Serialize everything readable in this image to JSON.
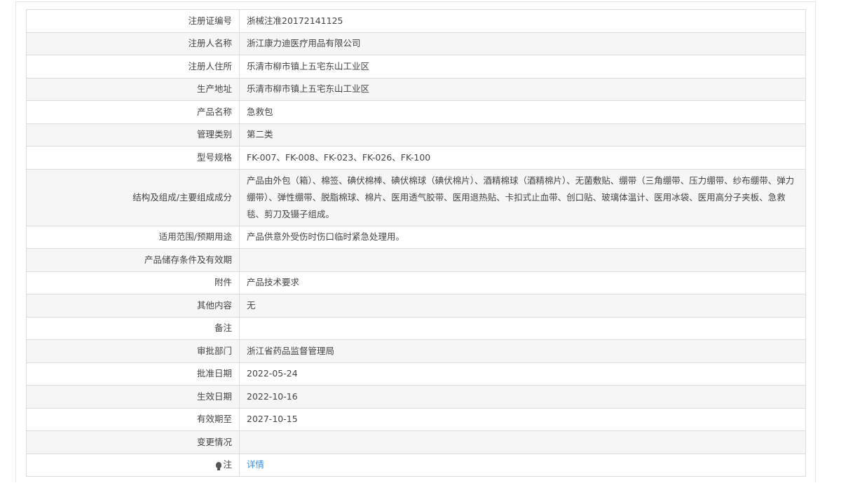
{
  "rows": [
    {
      "label": "注册证编号",
      "value": "浙械注准20172141125"
    },
    {
      "label": "注册人名称",
      "value": "浙江康力迪医疗用品有限公司"
    },
    {
      "label": "注册人住所",
      "value": "乐清市柳市镇上五宅东山工业区"
    },
    {
      "label": "生产地址",
      "value": "乐清市柳市镇上五宅东山工业区"
    },
    {
      "label": "产品名称",
      "value": "急救包"
    },
    {
      "label": "管理类别",
      "value": "第二类"
    },
    {
      "label": "型号规格",
      "value": "FK-007、FK-008、FK-023、FK-026、FK-100"
    },
    {
      "label": "结构及组成/主要组成成分",
      "value": "产品由外包（箱）、棉签、碘伏棉棒、碘伏棉球（碘伏棉片）、酒精棉球（酒精棉片）、无菌敷贴、绷带（三角绷带、压力绷带、纱布绷带、弹力绷带）、弹性绷带、脱脂棉球、棉片、医用透气胶带、医用退热贴、卡扣式止血带、创口贴、玻璃体温计、医用冰袋、医用高分子夹板、急救毯、剪刀及镊子组成。"
    },
    {
      "label": "适用范围/预期用途",
      "value": "产品供意外受伤时伤口临时紧急处理用。"
    },
    {
      "label": "产品储存条件及有效期",
      "value": ""
    },
    {
      "label": "附件",
      "value": "产品技术要求"
    },
    {
      "label": "其他内容",
      "value": "无"
    },
    {
      "label": "备注",
      "value": ""
    },
    {
      "label": "审批部门",
      "value": "浙江省药品监督管理局"
    },
    {
      "label": "批准日期",
      "value": "2022-05-24"
    },
    {
      "label": "生效日期",
      "value": "2022-10-16"
    },
    {
      "label": "有效期至",
      "value": "2027-10-15"
    },
    {
      "label": "变更情况",
      "value": ""
    }
  ],
  "note": {
    "label": "注",
    "link": "详情",
    "icon": "lightbulb-icon"
  }
}
